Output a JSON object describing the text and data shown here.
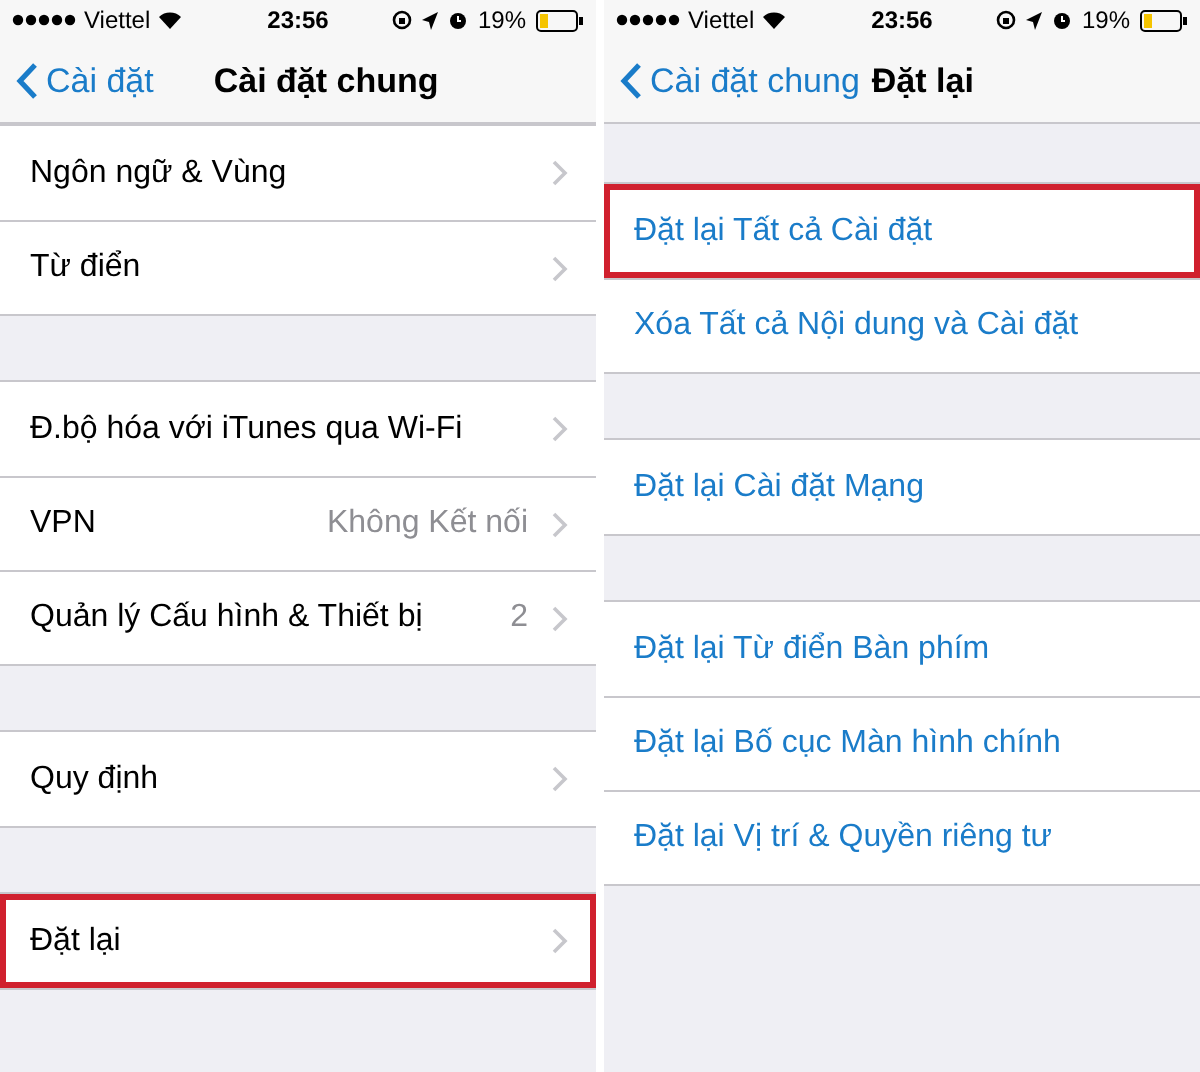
{
  "screens": [
    {
      "status_bar": {
        "carrier": "Viettel",
        "time": "23:56",
        "battery": "19%"
      },
      "nav": {
        "back": "Cài đặt",
        "title": "Cài đặt chung"
      },
      "scrolled": true,
      "groups": [
        [
          {
            "kind": "link",
            "label": "Ngôn ngữ & Vùng",
            "highlighted": false
          },
          {
            "kind": "link",
            "label": "Từ điển",
            "highlighted": false
          }
        ],
        [
          {
            "kind": "link",
            "label": "Đ.bộ hóa với iTunes qua Wi-Fi",
            "highlighted": false
          },
          {
            "kind": "link",
            "label": "VPN",
            "value": "Không Kết nối",
            "highlighted": false
          },
          {
            "kind": "link",
            "label": "Quản lý Cấu hình & Thiết bị",
            "value": "2",
            "highlighted": false
          }
        ],
        [
          {
            "kind": "link",
            "label": "Quy định",
            "highlighted": false
          }
        ],
        [
          {
            "kind": "link",
            "label": "Đặt lại",
            "highlighted": true
          }
        ]
      ]
    },
    {
      "status_bar": {
        "carrier": "Viettel",
        "time": "23:56",
        "battery": "19%"
      },
      "nav": {
        "back": "Cài đặt chung",
        "title": "Đặt lại"
      },
      "scrolled": false,
      "groups": [
        [
          {
            "kind": "action",
            "label": "Đặt lại Tất cả Cài đặt",
            "highlighted": true
          },
          {
            "kind": "action",
            "label": "Xóa Tất cả Nội dung và Cài đặt",
            "highlighted": false
          }
        ],
        [
          {
            "kind": "action",
            "label": "Đặt lại Cài đặt Mạng",
            "highlighted": false
          }
        ],
        [
          {
            "kind": "action",
            "label": "Đặt lại Từ điển Bàn phím",
            "highlighted": false
          },
          {
            "kind": "action",
            "label": "Đặt lại Bố cục Màn hình chính",
            "highlighted": false
          },
          {
            "kind": "action",
            "label": "Đặt lại Vị trí & Quyền riêng tư",
            "highlighted": false
          }
        ]
      ]
    }
  ]
}
